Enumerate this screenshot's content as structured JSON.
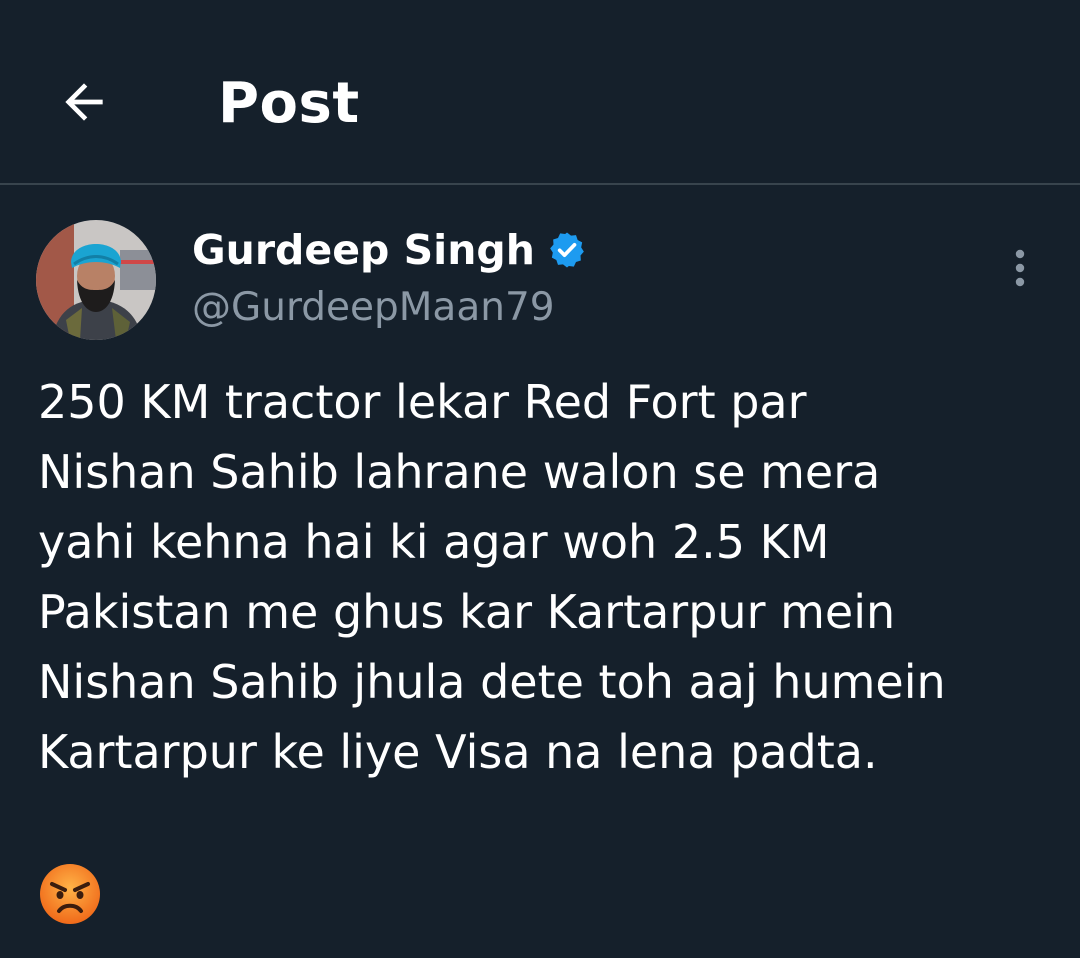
{
  "header": {
    "title": "Post",
    "back_icon": "arrow-left-icon"
  },
  "author": {
    "display_name": "Gurdeep Singh",
    "handle": "@GurdeepMaan79",
    "verified": true,
    "verified_icon": "verified-badge-icon",
    "verified_color": "#1d9bf0",
    "avatar": "avatar"
  },
  "menu": {
    "more_icon": "more-vertical-icon"
  },
  "post": {
    "text": "250 KM tractor lekar Red Fort par\nNishan Sahib lahrane walon se mera\nyahi kehna hai ki agar woh 2.5 KM\nPakistan me ghus kar Kartarpur mein\nNishan Sahib jhula dete toh aaj humein\nKartarpur ke liye Visa na lena padta.",
    "emoji": "angry-face-emoji"
  },
  "colors": {
    "background": "#15202b",
    "divider": "#38444d",
    "secondary_text": "#8b98a5",
    "accent": "#1d9bf0"
  }
}
